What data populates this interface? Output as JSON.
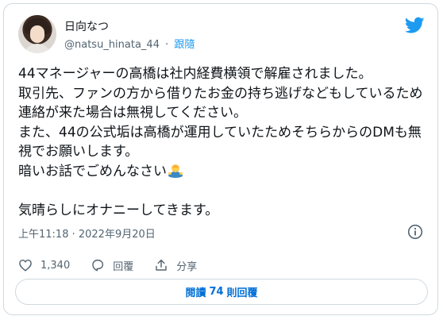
{
  "author": {
    "display_name": "日向なつ",
    "handle": "@natsu_hinata_44",
    "separator": "·",
    "follow_label": "跟隨"
  },
  "tweet": {
    "text": "44マネージャーの高橋は社内経費横領で解雇されました。\n取引先、ファンの方から借りたお金の持ち逃げなどもしているため連絡が来た場合は無視してください。\nまた、44の公式垢は高橋が運用していたためそちらからのDMも無視でお願いします。\n暗いお話でごめんなさい",
    "text_last": "気晴らしにオナニーしてきます。",
    "emoji": "person-bowing-emoji",
    "timestamp": "上午11:18 · 2022年9月20日"
  },
  "actions": {
    "like_count": "1,340",
    "reply_label": "回覆",
    "share_label": "分享"
  },
  "read_replies": {
    "prefix": "閱讀",
    "count": "74",
    "suffix": "則回覆"
  },
  "colors": {
    "brand": "#1d9bf0",
    "link": "#006fd6",
    "muted": "#536471"
  }
}
